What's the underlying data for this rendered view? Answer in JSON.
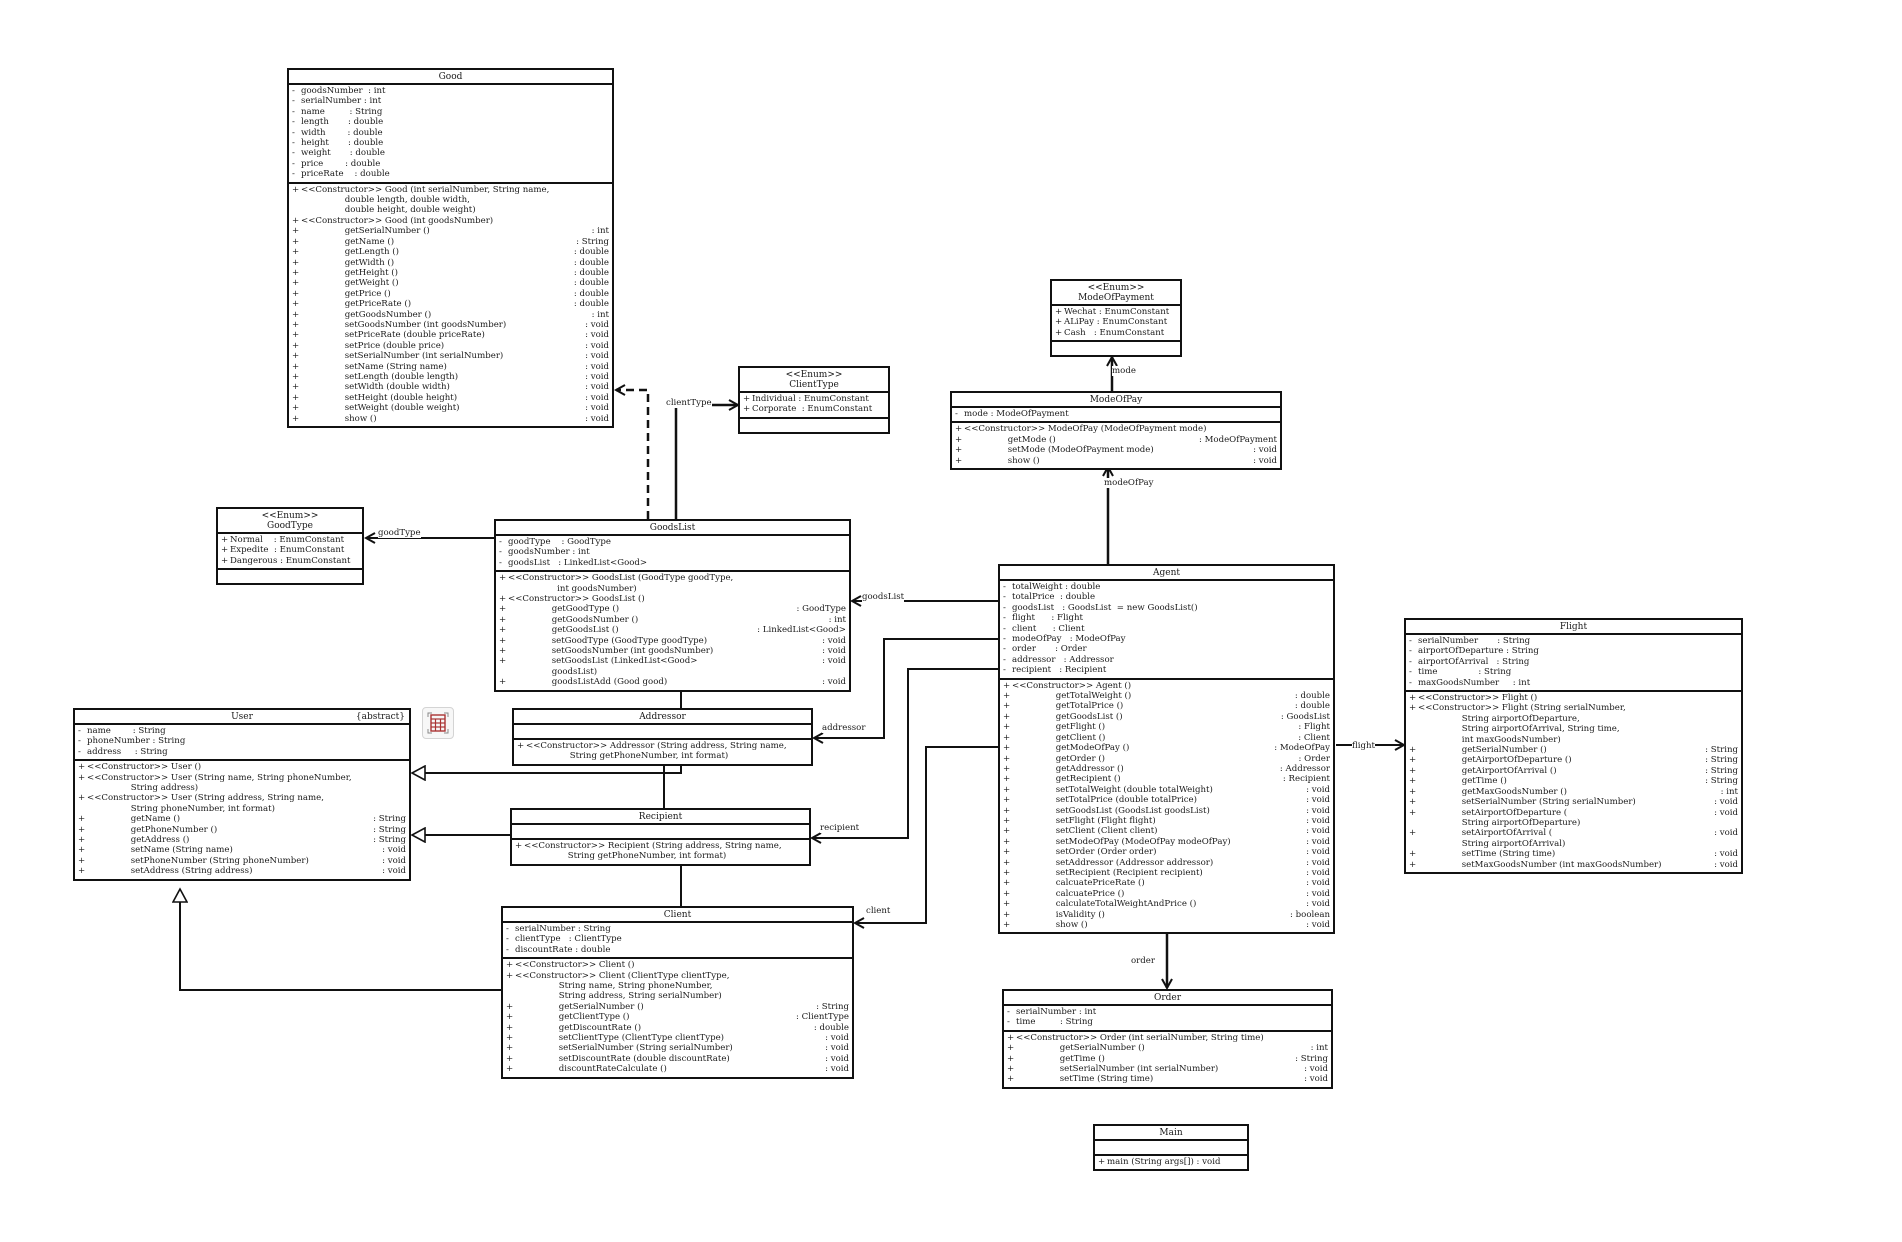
{
  "classes": {
    "good": {
      "name": "Good",
      "attributes": [
        [
          "-",
          "goodsNumber  : int"
        ],
        [
          "-",
          "serialNumber : int"
        ],
        [
          "-",
          "name         : String"
        ],
        [
          "-",
          "length       : double"
        ],
        [
          "-",
          "width        : double"
        ],
        [
          "-",
          "height       : double"
        ],
        [
          "-",
          "weight       : double"
        ],
        [
          "-",
          "price        : double"
        ],
        [
          "-",
          "priceRate    : double"
        ]
      ],
      "methods": [
        [
          "+",
          "<<Constructor>> Good (int serialNumber, String name,\n                double length, double width,\n                double height, double weight)",
          ""
        ],
        [
          "+",
          "<<Constructor>> Good (int goodsNumber)",
          ""
        ],
        [
          "+",
          "                getSerialNumber ()",
          ": int"
        ],
        [
          "+",
          "                getName ()",
          ": String"
        ],
        [
          "+",
          "                getLength ()",
          ": double"
        ],
        [
          "+",
          "                getWidth ()",
          ": double"
        ],
        [
          "+",
          "                getHeight ()",
          ": double"
        ],
        [
          "+",
          "                getWeight ()",
          ": double"
        ],
        [
          "+",
          "                getPrice ()",
          ": double"
        ],
        [
          "+",
          "                getPriceRate ()",
          ": double"
        ],
        [
          "+",
          "                getGoodsNumber ()",
          ": int"
        ],
        [
          "+",
          "                setGoodsNumber (int goodsNumber)",
          ": void"
        ],
        [
          "+",
          "                setPriceRate (double priceRate)",
          ": void"
        ],
        [
          "+",
          "                setPrice (double price)",
          ": void"
        ],
        [
          "+",
          "                setSerialNumber (int serialNumber)",
          ": void"
        ],
        [
          "+",
          "                setName (String name)",
          ": void"
        ],
        [
          "+",
          "                setLength (double length)",
          ": void"
        ],
        [
          "+",
          "                setWidth (double width)",
          ": void"
        ],
        [
          "+",
          "                setHeight (double height)",
          ": void"
        ],
        [
          "+",
          "                setWeight (double weight)",
          ": void"
        ],
        [
          "+",
          "                show ()",
          ": void"
        ]
      ]
    },
    "clientType": {
      "stereotype": "<<Enum>>",
      "name": "ClientType",
      "attributes": [
        [
          "+",
          "Individual : EnumConstant"
        ],
        [
          "+",
          "Corporate  : EnumConstant"
        ]
      ],
      "methods": []
    },
    "goodType": {
      "stereotype": "<<Enum>>",
      "name": "GoodType",
      "attributes": [
        [
          "+",
          "Normal    : EnumConstant"
        ],
        [
          "+",
          "Expedite  : EnumConstant"
        ],
        [
          "+",
          "Dangerous : EnumConstant"
        ]
      ],
      "methods": []
    },
    "goodsList": {
      "name": "GoodsList",
      "attributes": [
        [
          "-",
          "goodType    : GoodType"
        ],
        [
          "-",
          "goodsNumber : int"
        ],
        [
          "-",
          "goodsList   : LinkedList<Good>"
        ]
      ],
      "methods": [
        [
          "+",
          "<<Constructor>> GoodsList (GoodType goodType,\n                  int goodsNumber)",
          ""
        ],
        [
          "+",
          "<<Constructor>> GoodsList ()",
          ""
        ],
        [
          "+",
          "                getGoodType ()",
          ": GoodType"
        ],
        [
          "+",
          "                getGoodsNumber ()",
          ": int"
        ],
        [
          "+",
          "                getGoodsList ()",
          ": LinkedList<Good>"
        ],
        [
          "+",
          "                setGoodType (GoodType goodType)",
          ": void"
        ],
        [
          "+",
          "                setGoodsNumber (int goodsNumber)",
          ": void"
        ],
        [
          "+",
          "                setGoodsList (LinkedList<Good>\n                goodsList)",
          ": void"
        ],
        [
          "+",
          "                goodsListAdd (Good good)",
          ": void"
        ]
      ]
    },
    "modeOfPaymentEnum": {
      "stereotype": "<<Enum>>",
      "name": "ModeOfPayment",
      "attributes": [
        [
          "+",
          "Wechat : EnumConstant"
        ],
        [
          "+",
          "ALiPay : EnumConstant"
        ],
        [
          "+",
          "Cash   : EnumConstant"
        ]
      ],
      "methods": []
    },
    "modeOfPay": {
      "name": "ModeOfPay",
      "attributes": [
        [
          "-",
          "mode : ModeOfPayment"
        ]
      ],
      "methods": [
        [
          "+",
          "<<Constructor>> ModeOfPay (ModeOfPayment mode)",
          ""
        ],
        [
          "+",
          "                getMode ()",
          ": ModeOfPayment"
        ],
        [
          "+",
          "                setMode (ModeOfPayment mode)",
          ": void"
        ],
        [
          "+",
          "                show ()",
          ": void"
        ]
      ]
    },
    "user": {
      "name": "User",
      "modifier": "{abstract}",
      "attributes": [
        [
          "-",
          "name        : String"
        ],
        [
          "-",
          "phoneNumber : String"
        ],
        [
          "-",
          "address     : String"
        ]
      ],
      "methods": [
        [
          "+",
          "<<Constructor>> User ()",
          ""
        ],
        [
          "+",
          "<<Constructor>> User (String name, String phoneNumber,\n                String address)",
          ""
        ],
        [
          "+",
          "<<Constructor>> User (String address, String name,\n                String phoneNumber, int format)",
          ""
        ],
        [
          "+",
          "                getName ()",
          ": String"
        ],
        [
          "+",
          "                getPhoneNumber ()",
          ": String"
        ],
        [
          "+",
          "                getAddress ()",
          ": String"
        ],
        [
          "+",
          "                setName (String name)",
          ": void"
        ],
        [
          "+",
          "                setPhoneNumber (String phoneNumber)",
          ": void"
        ],
        [
          "+",
          "                setAddress (String address)",
          ": void"
        ]
      ]
    },
    "addressor": {
      "name": "Addressor",
      "attributes": [],
      "methods": [
        [
          "+",
          "<<Constructor>> Addressor (String address, String name,\n                String getPhoneNumber, int format)",
          ""
        ]
      ]
    },
    "recipient": {
      "name": "Recipient",
      "attributes": [],
      "methods": [
        [
          "+",
          "<<Constructor>> Recipient (String address, String name,\n                String getPhoneNumber, int format)",
          ""
        ]
      ]
    },
    "client": {
      "name": "Client",
      "attributes": [
        [
          "-",
          "serialNumber : String"
        ],
        [
          "-",
          "clientType   : ClientType"
        ],
        [
          "-",
          "discountRate : double"
        ]
      ],
      "methods": [
        [
          "+",
          "<<Constructor>> Client ()",
          ""
        ],
        [
          "+",
          "<<Constructor>> Client (ClientType clientType,\n                String name, String phoneNumber,\n                String address, String serialNumber)",
          ""
        ],
        [
          "+",
          "                getSerialNumber ()",
          ": String"
        ],
        [
          "+",
          "                getClientType ()",
          ": ClientType"
        ],
        [
          "+",
          "                getDiscountRate ()",
          ": double"
        ],
        [
          "+",
          "                setClientType (ClientType clientType)",
          ": void"
        ],
        [
          "+",
          "                setSerialNumber (String serialNumber)",
          ": void"
        ],
        [
          "+",
          "                setDiscountRate (double discountRate)",
          ": void"
        ],
        [
          "+",
          "                discountRateCalculate ()",
          ": void"
        ]
      ]
    },
    "agent": {
      "name": "Agent",
      "attributes": [
        [
          "-",
          "totalWeight : double"
        ],
        [
          "-",
          "totalPrice  : double"
        ],
        [
          "-",
          "goodsList   : GoodsList  = new GoodsList()"
        ],
        [
          "-",
          "flight      : Flight"
        ],
        [
          "-",
          "client      : Client"
        ],
        [
          "-",
          "modeOfPay   : ModeOfPay"
        ],
        [
          "-",
          "order       : Order"
        ],
        [
          "-",
          "addressor   : Addressor"
        ],
        [
          "-",
          "recipient   : Recipient"
        ]
      ],
      "methods": [
        [
          "+",
          "<<Constructor>> Agent ()",
          ""
        ],
        [
          "+",
          "                getTotalWeight ()",
          ": double"
        ],
        [
          "+",
          "                getTotalPrice ()",
          ": double"
        ],
        [
          "+",
          "                getGoodsList ()",
          ": GoodsList"
        ],
        [
          "+",
          "                getFlight ()",
          ": Flight"
        ],
        [
          "+",
          "                getClient ()",
          ": Client"
        ],
        [
          "+",
          "                getModeOfPay ()",
          ": ModeOfPay"
        ],
        [
          "+",
          "                getOrder ()",
          ": Order"
        ],
        [
          "+",
          "                getAddressor ()",
          ": Addressor"
        ],
        [
          "+",
          "                getRecipient ()",
          ": Recipient"
        ],
        [
          "+",
          "                setTotalWeight (double totalWeight)",
          ": void"
        ],
        [
          "+",
          "                setTotalPrice (double totalPrice)",
          ": void"
        ],
        [
          "+",
          "                setGoodsList (GoodsList goodsList)",
          ": void"
        ],
        [
          "+",
          "                setFlight (Flight flight)",
          ": void"
        ],
        [
          "+",
          "                setClient (Client client)",
          ": void"
        ],
        [
          "+",
          "                setModeOfPay (ModeOfPay modeOfPay)",
          ": void"
        ],
        [
          "+",
          "                setOrder (Order order)",
          ": void"
        ],
        [
          "+",
          "                setAddressor (Addressor addressor)",
          ": void"
        ],
        [
          "+",
          "                setRecipient (Recipient recipient)",
          ": void"
        ],
        [
          "+",
          "                calcuatePriceRate ()",
          ": void"
        ],
        [
          "+",
          "                calcuatePrice ()",
          ": void"
        ],
        [
          "+",
          "                calculateTotalWeightAndPrice ()",
          ": void"
        ],
        [
          "+",
          "                isValidity ()",
          ": boolean"
        ],
        [
          "+",
          "                show ()",
          ": void"
        ]
      ]
    },
    "flight": {
      "name": "Flight",
      "attributes": [
        [
          "-",
          "serialNumber       : String"
        ],
        [
          "-",
          "airportOfDeparture : String"
        ],
        [
          "-",
          "airportOfArrival   : String"
        ],
        [
          "-",
          "time               : String"
        ],
        [
          "-",
          "maxGoodsNumber     : int"
        ]
      ],
      "methods": [
        [
          "+",
          "<<Constructor>> Flight ()",
          ""
        ],
        [
          "+",
          "<<Constructor>> Flight (String serialNumber,\n                String airportOfDeparture,\n                String airportOfArrival, String time,\n                int maxGoodsNumber)",
          ""
        ],
        [
          "+",
          "                getSerialNumber ()",
          ": String"
        ],
        [
          "+",
          "                getAirportOfDeparture ()",
          ": String"
        ],
        [
          "+",
          "                getAirportOfArrival ()",
          ": String"
        ],
        [
          "+",
          "                getTime ()",
          ": String"
        ],
        [
          "+",
          "                getMaxGoodsNumber ()",
          ": int"
        ],
        [
          "+",
          "                setSerialNumber (String serialNumber)",
          ": void"
        ],
        [
          "+",
          "                setAirportOfDeparture (\n                String airportOfDeparture)",
          ": void"
        ],
        [
          "+",
          "                setAirportOfArrival (\n                String airportOfArrival)",
          ": void"
        ],
        [
          "+",
          "                setTime (String time)",
          ": void"
        ],
        [
          "+",
          "                setMaxGoodsNumber (int maxGoodsNumber)",
          ": void"
        ]
      ]
    },
    "order": {
      "name": "Order",
      "attributes": [
        [
          "-",
          "serialNumber : int"
        ],
        [
          "-",
          "time         : String"
        ]
      ],
      "methods": [
        [
          "+",
          "<<Constructor>> Order (int serialNumber, String time)",
          ""
        ],
        [
          "+",
          "                getSerialNumber ()",
          ": int"
        ],
        [
          "+",
          "                getTime ()",
          ": String"
        ],
        [
          "+",
          "                setSerialNumber (int serialNumber)",
          ": void"
        ],
        [
          "+",
          "                setTime (String time)",
          ": void"
        ]
      ]
    },
    "main": {
      "name": "Main",
      "attributes": [],
      "methods": [
        [
          "+",
          "main (String args[]) : void",
          ""
        ]
      ]
    }
  },
  "relations": {
    "clientType": "clientType",
    "goodType": "goodType",
    "goodsList": "goodsList",
    "mode": "mode",
    "modeOfPay": "modeOfPay",
    "addressor": "addressor",
    "recipient": "recipient",
    "client": "client",
    "flight": "flight",
    "order": "order"
  },
  "toolbar": {
    "icon": "table-grid-icon"
  },
  "colors": {
    "line": "#111111",
    "background": "#ffffff"
  }
}
